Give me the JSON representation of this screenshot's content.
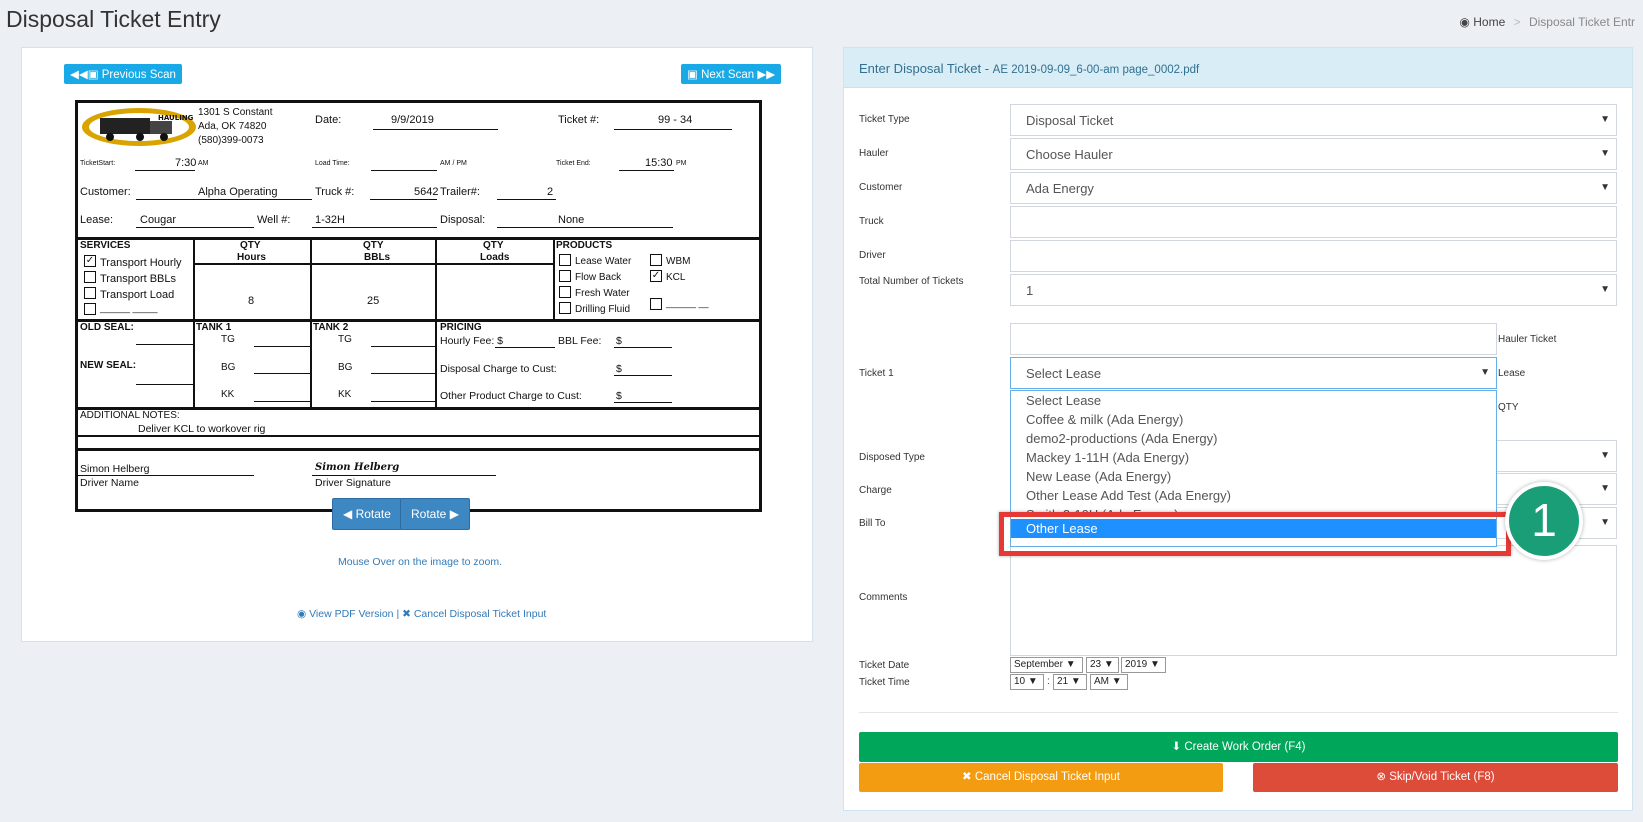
{
  "page": {
    "title": "Disposal Ticket Entry"
  },
  "breadcrumb": {
    "home": "Home",
    "current": "Disposal Ticket Entr"
  },
  "scan_nav": {
    "prev": "Previous Scan",
    "next": "Next Scan"
  },
  "ticket": {
    "company": {
      "addr1": "1301 S Constant",
      "addr2": "Ada, OK 74820",
      "phone": "(580)399-0073",
      "logo_text": "HAULING"
    },
    "date_label": "Date:",
    "date": "9/9/2019",
    "ticket_no_label": "Ticket #:",
    "ticket_no": "99 - 34",
    "start_label": "TicketStart:",
    "start": "7:30",
    "am": "AM",
    "load_label": "Load Time:",
    "ampm": "AM / PM",
    "end_label": "Ticket End:",
    "end": "15:30",
    "pm": "PM",
    "customer_label": "Customer:",
    "customer": "Alpha Operating",
    "truck_label": "Truck #:",
    "truck": "5642",
    "trailer_label": "Trailer#:",
    "trailer": "2",
    "lease_label": "Lease:",
    "lease": "Cougar",
    "well_label": "Well #:",
    "well": "1-32H",
    "disposal_label": "Disposal:",
    "disposal": "None",
    "services": "SERVICES",
    "svc1": "Transport Hourly",
    "svc2": "Transport BBLs",
    "svc3": "Transport Load",
    "svc_blank": "______ _____",
    "qty": "QTY",
    "hours": "Hours",
    "bbls": "BBLs",
    "loads": "Loads",
    "hours_val": "8",
    "bbls_val": "25",
    "products": "PRODUCTS",
    "p1": "Lease Water",
    "p2": "Flow Back",
    "p3": "Fresh Water",
    "p4": "Drilling Fluid",
    "p5": "WBM",
    "p6": "KCL",
    "p_blank": "______ __",
    "old_seal": "OLD SEAL:",
    "new_seal": "NEW SEAL:",
    "tank1": "TANK 1",
    "tank2": "TANK 2",
    "tg": "TG",
    "bg": "BG",
    "kk": "KK",
    "pricing": "PRICING",
    "hourly_fee": "Hourly Fee: $",
    "bbl_fee": "BBL Fee:",
    "dollar": "$",
    "disposal_charge": "Disposal Charge to Cust:",
    "other_charge": "Other Product Charge to Cust:",
    "notes_label": "ADDITIONAL NOTES:",
    "notes": "Deliver KCL to workover rig",
    "driver": "Simon Helberg",
    "driver_name_label": "Driver Name",
    "signature": "Simon Helberg",
    "signature_label": "Driver Signature"
  },
  "rotate": {
    "left": "Rotate",
    "right": "Rotate"
  },
  "zoom_hint": "Mouse Over on the image to zoom.",
  "links": {
    "view_pdf": "View PDF Version",
    "sep": "|",
    "cancel": "Cancel Disposal Ticket Input"
  },
  "form": {
    "heading": "Enter Disposal Ticket",
    "file": "AE 2019-09-09_6-00-am page_0002.pdf",
    "ticket_type_label": "Ticket Type",
    "ticket_type": "Disposal Ticket",
    "hauler_label": "Hauler",
    "hauler": "Choose Hauler",
    "customer_label": "Customer",
    "customer": "Ada Energy",
    "truck_label": "Truck",
    "driver_label": "Driver",
    "total_label": "Total Number of Tickets",
    "total": "1",
    "ticket1_label": "Ticket 1",
    "hauler_ticket_label": "Hauler Ticket",
    "lease_label": "Lease",
    "qty_label": "QTY",
    "lease_select": "Select Lease",
    "lease_options": [
      "Select Lease",
      "Coffee & milk (Ada Energy)",
      "demo2-productions (Ada Energy)",
      "Mackey 1-11H (Ada Energy)",
      "New Lease (Ada Energy)",
      "Other Lease Add Test (Ada Energy)",
      "Smith 2-10H (Ada Energy)"
    ],
    "lease_highlighted": "Other Lease",
    "disposed_type_label": "Disposed Type",
    "charge_label": "Charge",
    "bill_to_label": "Bill To",
    "comments_label": "Comments",
    "ticket_date_label": "Ticket Date",
    "month": "September",
    "day": "23",
    "year": "2019",
    "ticket_time_label": "Ticket Time",
    "hour": "10",
    "colon": ":",
    "minute": "21",
    "meridiem": "AM",
    "create": "Create Work Order (F4)",
    "cancel": "Cancel Disposal Ticket Input",
    "skip": "Skip/Void Ticket (F8)"
  },
  "callout": {
    "number": "1"
  },
  "colors": {
    "green": "#00a65a",
    "orange": "#f39c12",
    "red": "#dd4b39",
    "info": "#18a9e6",
    "highlight": "#1e90ff",
    "callout_box": "#e53935",
    "callout_circle": "#1a9e77"
  }
}
